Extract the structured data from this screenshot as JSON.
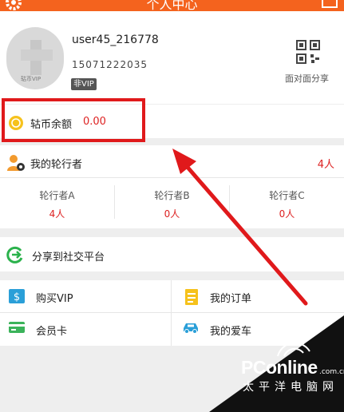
{
  "header": {
    "title": "个人中心"
  },
  "profile": {
    "username": "user45_216778",
    "phone": "15071222035",
    "vip_tag": "非VIP",
    "avatar_badge": "轱币VIP",
    "qr_label": "面对面分享"
  },
  "balance": {
    "label": "轱币余额",
    "value": "0.00"
  },
  "riders": {
    "title": "我的轮行者",
    "count": "4人",
    "columns": [
      {
        "name": "轮行者A",
        "count": "4人"
      },
      {
        "name": "轮行者B",
        "count": "0人"
      },
      {
        "name": "轮行者C",
        "count": "0人"
      }
    ]
  },
  "share": {
    "label": "分享到社交平台"
  },
  "menu": {
    "buy_vip": "购买VIP",
    "orders": "我的订单",
    "member_card": "会员卡",
    "my_car": "我的爱车"
  },
  "watermark": {
    "brand": "PConline",
    "domain": ".com.cn",
    "cn": "太平洋电脑网"
  },
  "colors": {
    "accent": "#f4631e",
    "highlight": "#e0191b",
    "value": "#dd2222"
  }
}
